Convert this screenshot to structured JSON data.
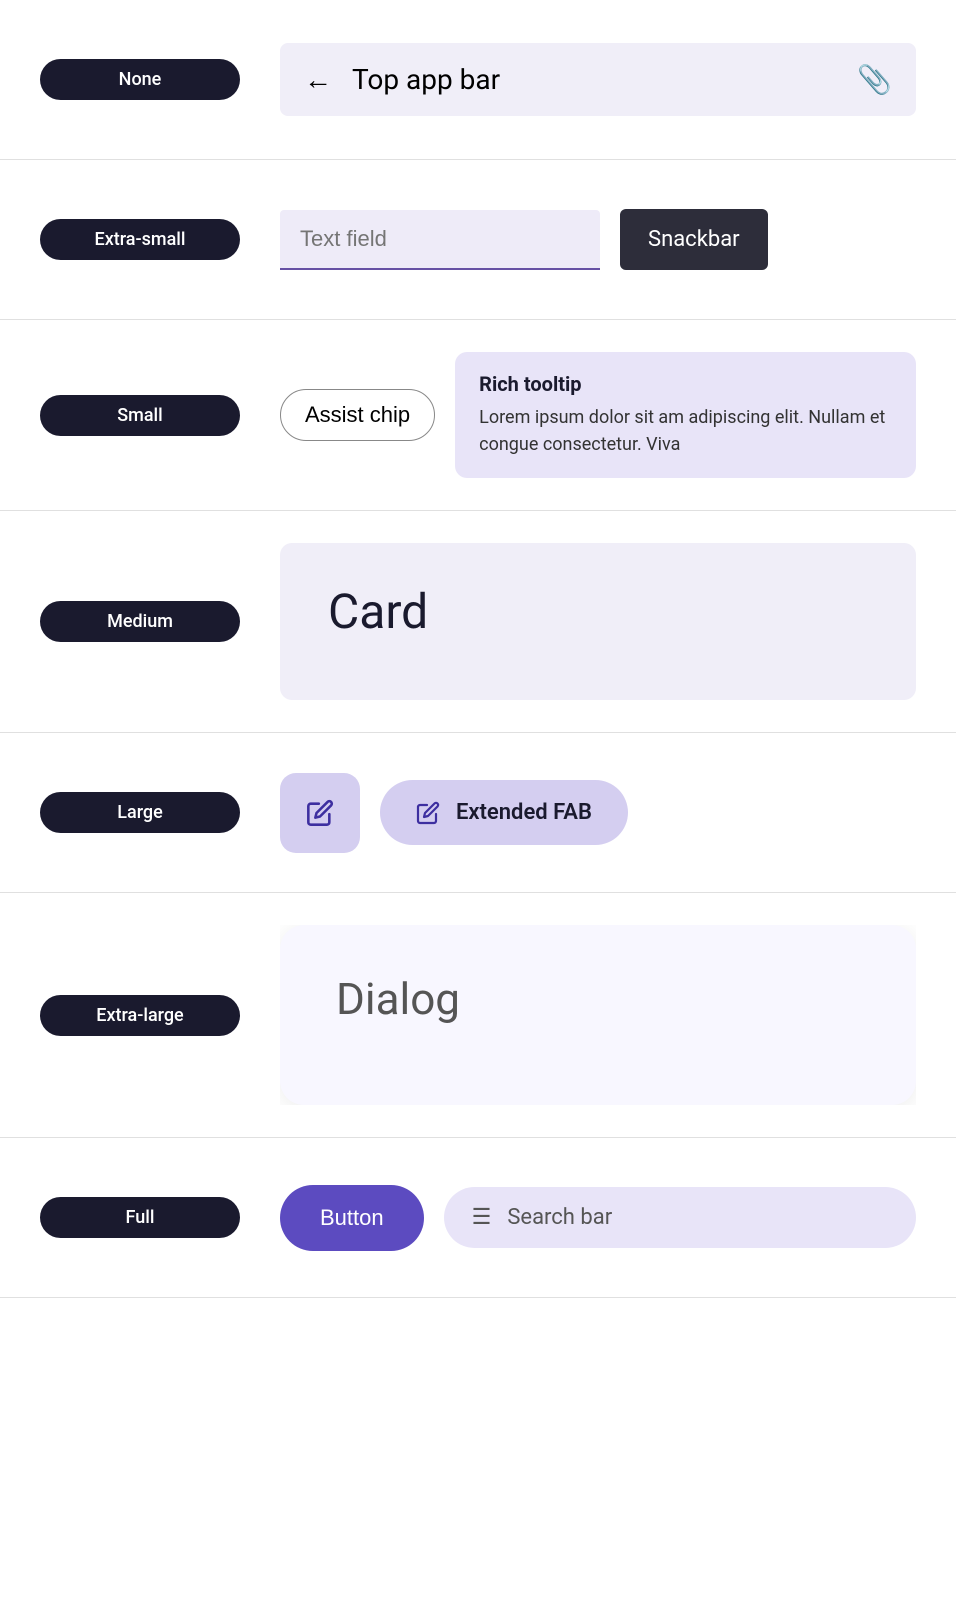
{
  "rows": [
    {
      "id": "none-row",
      "badge": "None",
      "topAppBar": {
        "backLabel": "←",
        "title": "Top app bar",
        "icon": "📎"
      }
    },
    {
      "id": "extra-small-row",
      "badge": "Extra-small",
      "textField": {
        "placeholder": "Text field"
      },
      "snackbar": {
        "label": "Snackbar"
      }
    },
    {
      "id": "small-row",
      "badge": "Small",
      "assistChip": {
        "label": "Assist chip"
      },
      "richTooltip": {
        "title": "Rich tooltip",
        "text": "Lorem ipsum dolor sit am adipiscing elit. Nullam et congue consectetur. Viva"
      }
    },
    {
      "id": "medium-row",
      "badge": "Medium",
      "card": {
        "title": "Card"
      }
    },
    {
      "id": "large-row",
      "badge": "Large",
      "fab": {
        "icon": "✏️"
      },
      "extendedFab": {
        "icon": "✏️",
        "label": "Extended FAB"
      }
    },
    {
      "id": "extra-large-row",
      "badge": "Extra-large",
      "dialog": {
        "title": "Dialog"
      }
    },
    {
      "id": "full-row",
      "badge": "Full",
      "button": {
        "label": "Button"
      },
      "searchBar": {
        "icon": "☰",
        "placeholder": "Search bar"
      }
    }
  ]
}
